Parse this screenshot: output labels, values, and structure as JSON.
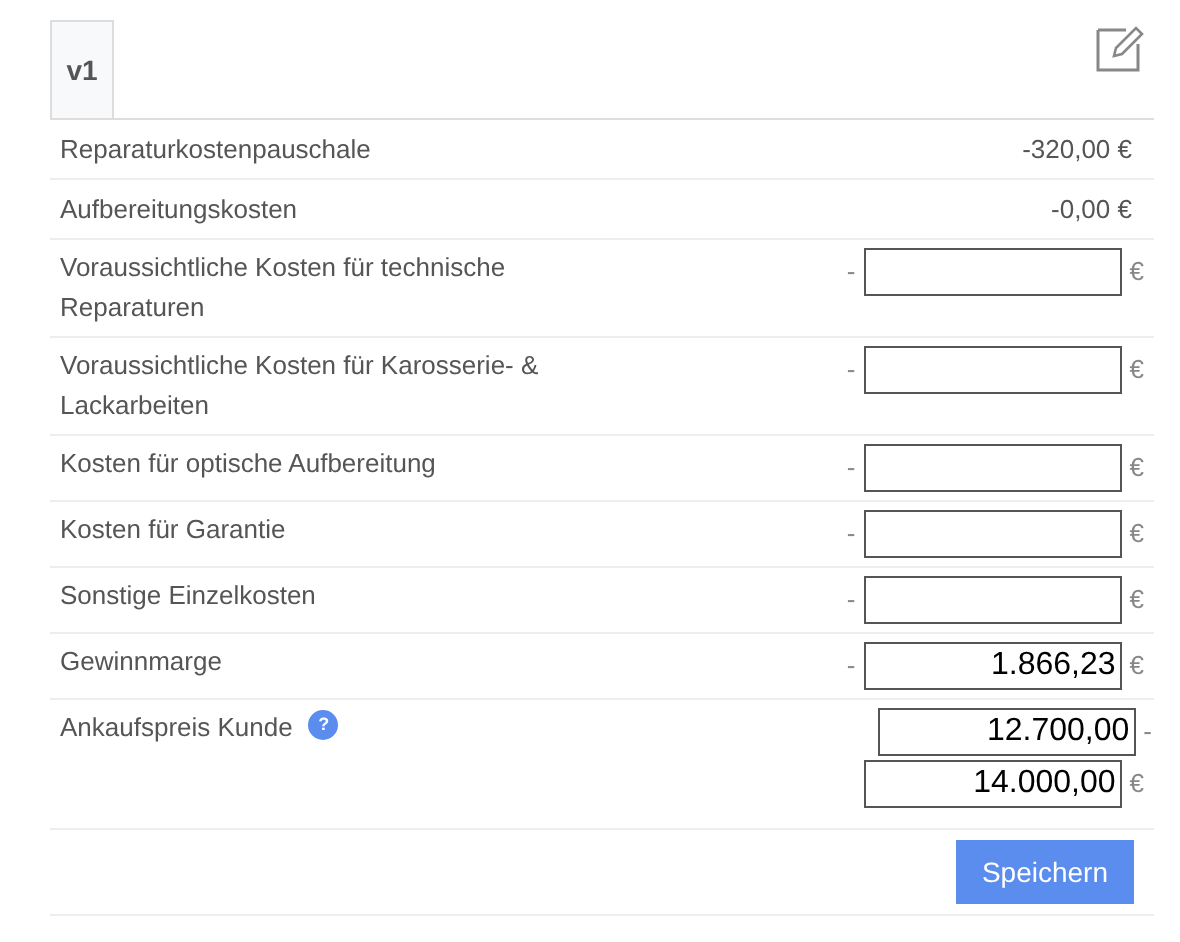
{
  "tabs": [
    {
      "label": "v1",
      "selected": true
    }
  ],
  "rows": [
    {
      "kind": "text",
      "label": "Reparaturkostenpauschale",
      "value": "-320,00 €"
    },
    {
      "kind": "text",
      "label": "Aufbereitungskosten",
      "value": "-0,00 €"
    },
    {
      "kind": "input",
      "label": "Voraussichtliche Kosten für technische Reparaturen",
      "prefix": "-",
      "suffix": "€"
    },
    {
      "kind": "input",
      "label": "Voraussichtliche Kosten für Karosserie- & Lackarbeiten",
      "prefix": "-",
      "suffix": "€"
    },
    {
      "kind": "input",
      "label": "Kosten für optische Aufbereitung",
      "prefix": "-",
      "suffix": "€"
    },
    {
      "kind": "input",
      "label": "Kosten für Garantie",
      "prefix": "-",
      "suffix": "€"
    },
    {
      "kind": "input",
      "label": "Sonstige Einzelkosten",
      "prefix": "-",
      "suffix": "€"
    },
    {
      "kind": "input",
      "label": "Gewinnmarge",
      "prefix": "-",
      "suffix": "€",
      "value": "1.866,23"
    },
    {
      "kind": "range",
      "label": "Ankaufspreis Kunde",
      "info_icon": "?",
      "inputs": [
        {
          "value": "12.700,00",
          "suffix": "-"
        },
        {
          "value": "14.000,00",
          "suffix": "€"
        }
      ]
    }
  ],
  "save_button": "Speichern"
}
